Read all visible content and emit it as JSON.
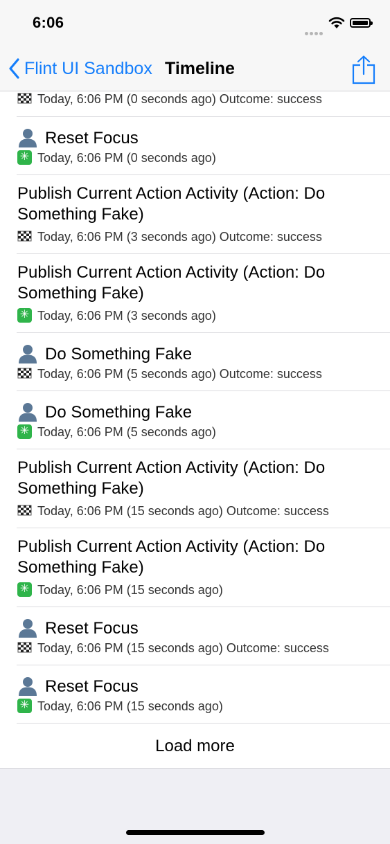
{
  "status_bar": {
    "time": "6:06"
  },
  "nav": {
    "back_label": "Flint UI Sandbox",
    "title": "Timeline"
  },
  "partial_row": {
    "subtitle": "Today, 6:06 PM (0 seconds ago) Outcome: success"
  },
  "rows": [
    {
      "title": "Reset Focus",
      "subtitle": "Today, 6:06 PM (0 seconds ago)"
    },
    {
      "title": "Publish Current Action Activity (Action: Do Something Fake)",
      "subtitle": "Today, 6:06 PM (3 seconds ago) Outcome: success"
    },
    {
      "title": "Publish Current Action Activity (Action: Do Something Fake)",
      "subtitle": "Today, 6:06 PM (3 seconds ago)"
    },
    {
      "title": "Do Something Fake",
      "subtitle": "Today, 6:06 PM (5 seconds ago) Outcome: success"
    },
    {
      "title": "Do Something Fake",
      "subtitle": "Today, 6:06 PM (5 seconds ago)"
    },
    {
      "title": "Publish Current Action Activity (Action: Do Something Fake)",
      "subtitle": "Today, 6:06 PM (15 seconds ago) Outcome: success"
    },
    {
      "title": "Publish Current Action Activity (Action: Do Something Fake)",
      "subtitle": "Today, 6:06 PM (15 seconds ago)"
    },
    {
      "title": "Reset Focus",
      "subtitle": "Today, 6:06 PM (15 seconds ago) Outcome: success"
    },
    {
      "title": "Reset Focus",
      "subtitle": "Today, 6:06 PM (15 seconds ago)"
    }
  ],
  "load_more_label": "Load more",
  "colors": {
    "accent": "#157efb",
    "start_icon": "#2fb44a"
  }
}
